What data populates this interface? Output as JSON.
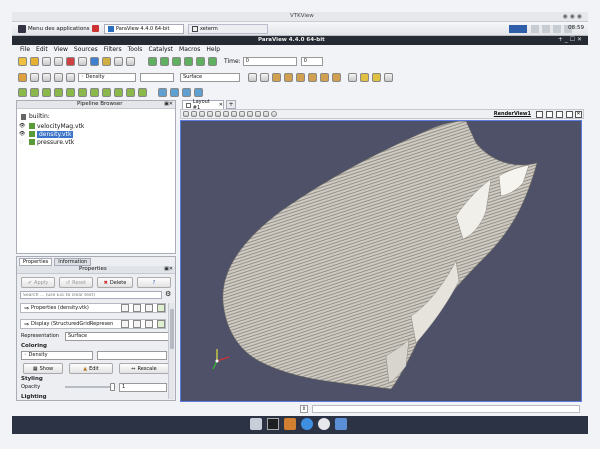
{
  "os": {
    "window_title": "VTKView",
    "taskbar": {
      "app_menu": "Menu des applications",
      "tasks": [
        "ParaView 4.4.0 64-bit",
        "xeterm"
      ],
      "clock": "08:59"
    }
  },
  "app": {
    "title": "ParaView 4.4.0 64-bit",
    "menu": [
      "File",
      "Edit",
      "View",
      "Sources",
      "Filters",
      "Tools",
      "Catalyst",
      "Macros",
      "Help"
    ],
    "time_label": "Time:",
    "time_value": "0",
    "time_index": "0",
    "color_array": "Density",
    "representation_combo": "Surface"
  },
  "pipeline": {
    "title": "Pipeline Browser",
    "root": "builtin:",
    "items": [
      "velocityMag.vtk",
      "density.vtk",
      "pressure.vtk"
    ]
  },
  "properties": {
    "tabs": [
      "Properties",
      "Information"
    ],
    "header": "Properties",
    "apply": "Apply",
    "reset": "Reset",
    "delete": "Delete",
    "help": "?",
    "search_placeholder": "Search ... (use Esc to clear text)",
    "section_properties": "Properties (density.vtk)",
    "section_display": "Display (StructuredGridRepresen",
    "representation_label": "Representation",
    "representation_value": "Surface",
    "coloring_label": "Coloring",
    "coloring_value": "Density",
    "show_button": "Show",
    "edit_button": "Edit",
    "rescale_button": "Rescale",
    "styling_label": "Styling",
    "opacity_label": "Opacity",
    "opacity_value": "1",
    "lighting_label": "Lighting"
  },
  "view": {
    "tab": "Layout #1",
    "tab_add": "+",
    "render_view_label": "RenderView1",
    "background": "#4e5168"
  }
}
